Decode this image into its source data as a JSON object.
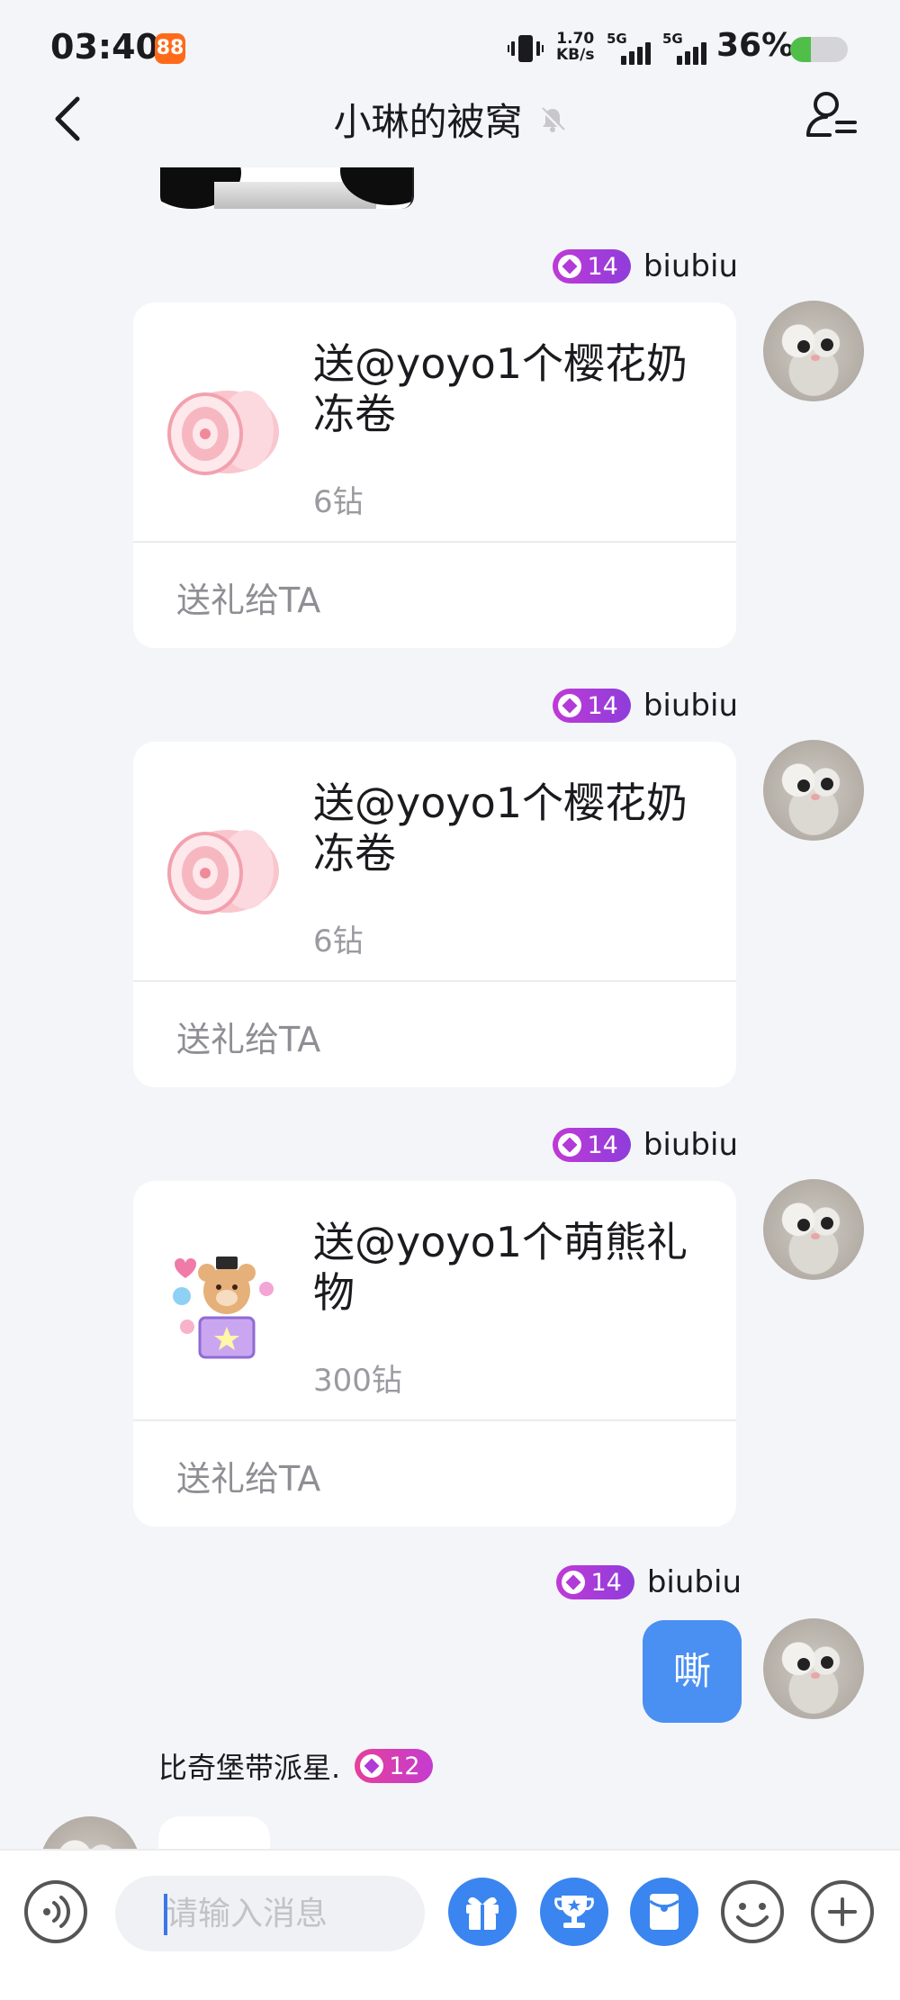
{
  "status_bar": {
    "time": "03:40",
    "app_badge": "88",
    "net_speed_value": "1.70",
    "net_speed_unit": "KB/s",
    "signal1_label": "5G",
    "signal2_label": "5G",
    "battery_percent": "36%",
    "battery_level": 0.36,
    "battery_color": "#4fbf4a"
  },
  "header": {
    "title": "小琳的被窝",
    "back_icon": "chevron-left-icon",
    "mute_icon": "bell-muted-icon",
    "profile_icon": "group-settings-icon"
  },
  "messages": [
    {
      "type": "gift",
      "level": "14",
      "username": "biubiu",
      "gift_title": "送@yoyo1个樱花奶冻卷",
      "gift_price": "6钻",
      "gift_action": "送礼给TA",
      "gift_icon": "sakura-roll-cake"
    },
    {
      "type": "gift",
      "level": "14",
      "username": "biubiu",
      "gift_title": "送@yoyo1个樱花奶冻卷",
      "gift_price": "6钻",
      "gift_action": "送礼给TA",
      "gift_icon": "sakura-roll-cake"
    },
    {
      "type": "gift",
      "level": "14",
      "username": "biubiu",
      "gift_title": "送@yoyo1个萌熊礼物",
      "gift_price": "300钻",
      "gift_action": "送礼给TA",
      "gift_icon": "teddy-bear-gift-box"
    },
    {
      "type": "text",
      "level": "14",
      "username": "biubiu",
      "text": "嘶"
    },
    {
      "type": "text-incoming",
      "level": "12",
      "username": "比奇堡带派星."
    }
  ],
  "input_bar": {
    "placeholder": "请输入消息",
    "voice_icon": "voice-icon",
    "gift_icon": "gift-icon",
    "trophy_icon": "trophy-icon",
    "red_packet_icon": "red-packet-icon",
    "emoji_icon": "emoji-icon",
    "plus_icon": "plus-icon",
    "accent_color": "#3a85ef"
  }
}
